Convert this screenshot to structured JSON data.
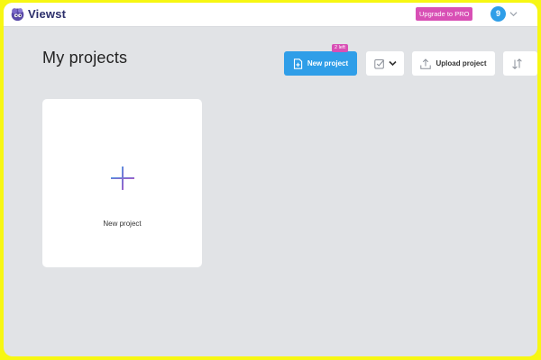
{
  "header": {
    "brand": "Viewst",
    "upgrade_label": "Upgrade to PRO",
    "avatar_initial": "9"
  },
  "page": {
    "title": "My projects"
  },
  "toolbar": {
    "new_project_label": "New project",
    "left_badge": "2 left",
    "upload_label": "Upload project"
  },
  "projects": {
    "new_card_label": "New project"
  },
  "colors": {
    "accent": "#2f9ee8",
    "pro": "#d84fb5",
    "outer_border": "#f7f713",
    "background": "#e1e3e6"
  },
  "icons": [
    "viewst-logo-icon",
    "chevron-down-icon",
    "file-plus-icon",
    "checkbox-icon",
    "upload-icon",
    "sort-icon",
    "plus-icon"
  ]
}
